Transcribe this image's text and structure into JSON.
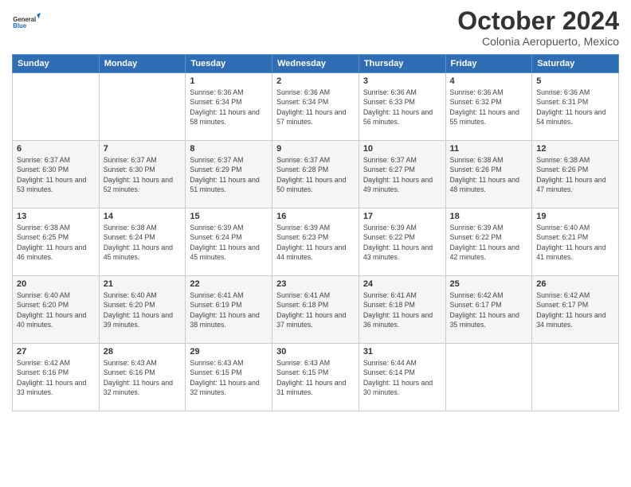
{
  "logo": {
    "general": "General",
    "blue": "Blue"
  },
  "header": {
    "title": "October 2024",
    "location": "Colonia Aeropuerto, Mexico"
  },
  "weekdays": [
    "Sunday",
    "Monday",
    "Tuesday",
    "Wednesday",
    "Thursday",
    "Friday",
    "Saturday"
  ],
  "weeks": [
    [
      {
        "day": "",
        "info": ""
      },
      {
        "day": "",
        "info": ""
      },
      {
        "day": "1",
        "sunrise": "6:36 AM",
        "sunset": "6:34 PM",
        "daylight": "11 hours and 58 minutes."
      },
      {
        "day": "2",
        "sunrise": "6:36 AM",
        "sunset": "6:34 PM",
        "daylight": "11 hours and 57 minutes."
      },
      {
        "day": "3",
        "sunrise": "6:36 AM",
        "sunset": "6:33 PM",
        "daylight": "11 hours and 56 minutes."
      },
      {
        "day": "4",
        "sunrise": "6:36 AM",
        "sunset": "6:32 PM",
        "daylight": "11 hours and 55 minutes."
      },
      {
        "day": "5",
        "sunrise": "6:36 AM",
        "sunset": "6:31 PM",
        "daylight": "11 hours and 54 minutes."
      }
    ],
    [
      {
        "day": "6",
        "sunrise": "6:37 AM",
        "sunset": "6:30 PM",
        "daylight": "11 hours and 53 minutes."
      },
      {
        "day": "7",
        "sunrise": "6:37 AM",
        "sunset": "6:30 PM",
        "daylight": "11 hours and 52 minutes."
      },
      {
        "day": "8",
        "sunrise": "6:37 AM",
        "sunset": "6:29 PM",
        "daylight": "11 hours and 51 minutes."
      },
      {
        "day": "9",
        "sunrise": "6:37 AM",
        "sunset": "6:28 PM",
        "daylight": "11 hours and 50 minutes."
      },
      {
        "day": "10",
        "sunrise": "6:37 AM",
        "sunset": "6:27 PM",
        "daylight": "11 hours and 49 minutes."
      },
      {
        "day": "11",
        "sunrise": "6:38 AM",
        "sunset": "6:26 PM",
        "daylight": "11 hours and 48 minutes."
      },
      {
        "day": "12",
        "sunrise": "6:38 AM",
        "sunset": "6:26 PM",
        "daylight": "11 hours and 47 minutes."
      }
    ],
    [
      {
        "day": "13",
        "sunrise": "6:38 AM",
        "sunset": "6:25 PM",
        "daylight": "11 hours and 46 minutes."
      },
      {
        "day": "14",
        "sunrise": "6:38 AM",
        "sunset": "6:24 PM",
        "daylight": "11 hours and 45 minutes."
      },
      {
        "day": "15",
        "sunrise": "6:39 AM",
        "sunset": "6:24 PM",
        "daylight": "11 hours and 45 minutes."
      },
      {
        "day": "16",
        "sunrise": "6:39 AM",
        "sunset": "6:23 PM",
        "daylight": "11 hours and 44 minutes."
      },
      {
        "day": "17",
        "sunrise": "6:39 AM",
        "sunset": "6:22 PM",
        "daylight": "11 hours and 43 minutes."
      },
      {
        "day": "18",
        "sunrise": "6:39 AM",
        "sunset": "6:22 PM",
        "daylight": "11 hours and 42 minutes."
      },
      {
        "day": "19",
        "sunrise": "6:40 AM",
        "sunset": "6:21 PM",
        "daylight": "11 hours and 41 minutes."
      }
    ],
    [
      {
        "day": "20",
        "sunrise": "6:40 AM",
        "sunset": "6:20 PM",
        "daylight": "11 hours and 40 minutes."
      },
      {
        "day": "21",
        "sunrise": "6:40 AM",
        "sunset": "6:20 PM",
        "daylight": "11 hours and 39 minutes."
      },
      {
        "day": "22",
        "sunrise": "6:41 AM",
        "sunset": "6:19 PM",
        "daylight": "11 hours and 38 minutes."
      },
      {
        "day": "23",
        "sunrise": "6:41 AM",
        "sunset": "6:18 PM",
        "daylight": "11 hours and 37 minutes."
      },
      {
        "day": "24",
        "sunrise": "6:41 AM",
        "sunset": "6:18 PM",
        "daylight": "11 hours and 36 minutes."
      },
      {
        "day": "25",
        "sunrise": "6:42 AM",
        "sunset": "6:17 PM",
        "daylight": "11 hours and 35 minutes."
      },
      {
        "day": "26",
        "sunrise": "6:42 AM",
        "sunset": "6:17 PM",
        "daylight": "11 hours and 34 minutes."
      }
    ],
    [
      {
        "day": "27",
        "sunrise": "6:42 AM",
        "sunset": "6:16 PM",
        "daylight": "11 hours and 33 minutes."
      },
      {
        "day": "28",
        "sunrise": "6:43 AM",
        "sunset": "6:16 PM",
        "daylight": "11 hours and 32 minutes."
      },
      {
        "day": "29",
        "sunrise": "6:43 AM",
        "sunset": "6:15 PM",
        "daylight": "11 hours and 32 minutes."
      },
      {
        "day": "30",
        "sunrise": "6:43 AM",
        "sunset": "6:15 PM",
        "daylight": "11 hours and 31 minutes."
      },
      {
        "day": "31",
        "sunrise": "6:44 AM",
        "sunset": "6:14 PM",
        "daylight": "11 hours and 30 minutes."
      },
      {
        "day": "",
        "info": ""
      },
      {
        "day": "",
        "info": ""
      }
    ]
  ]
}
